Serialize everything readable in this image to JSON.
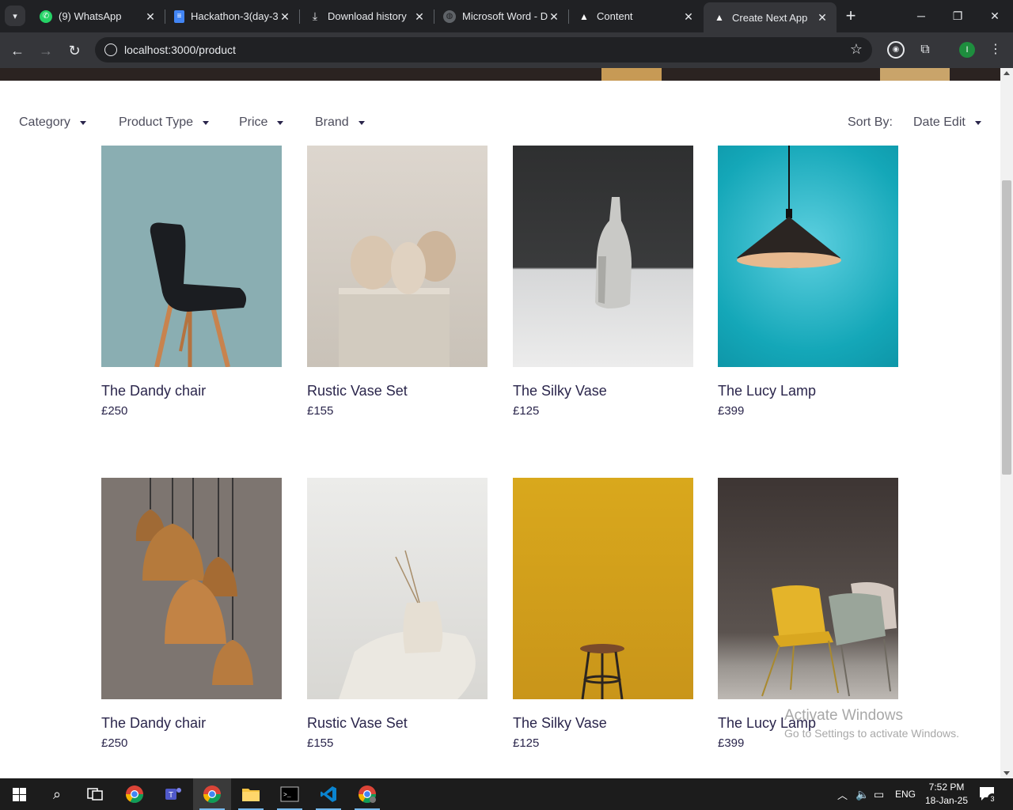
{
  "tabs": [
    {
      "title": "(9) WhatsApp",
      "icon": "whatsapp-icon"
    },
    {
      "title": "Hackathon-3(day-3",
      "icon": "docs-icon"
    },
    {
      "title": "Download history",
      "icon": "download-icon"
    },
    {
      "title": "Microsoft Word - D",
      "icon": "globe-icon"
    },
    {
      "title": "Content",
      "icon": "triangle-icon"
    },
    {
      "title": "Create Next App",
      "icon": "triangle-icon",
      "active": true
    }
  ],
  "address": {
    "url": "localhost:3000/product"
  },
  "profile": {
    "initial": "I"
  },
  "filters": {
    "category": "Category",
    "product_type": "Product Type",
    "price": "Price",
    "brand": "Brand",
    "sort_label": "Sort By:",
    "sort_value": "Date Edit"
  },
  "products": [
    {
      "name": "The Dandy chair",
      "price": "£250",
      "image": "black-chair"
    },
    {
      "name": "Rustic Vase Set",
      "price": "£155",
      "image": "clay-vases"
    },
    {
      "name": "The Silky Vase",
      "price": "£125",
      "image": "white-vase"
    },
    {
      "name": "The Lucy Lamp",
      "price": "£399",
      "image": "pendant-lamp"
    },
    {
      "name": "The Dandy chair",
      "price": "£250",
      "image": "copper-lamps"
    },
    {
      "name": "Rustic Vase Set",
      "price": "£155",
      "image": "ceramic-vase"
    },
    {
      "name": "The Silky Vase",
      "price": "£125",
      "image": "stool-yellow"
    },
    {
      "name": "The Lucy Lamp",
      "price": "£399",
      "image": "chairs-pair"
    }
  ],
  "watermark": {
    "line1": "Activate Windows",
    "line2": "Go to Settings to activate Windows."
  },
  "system_tray": {
    "lang": "ENG",
    "time": "7:52 PM",
    "date": "18-Jan-25",
    "notifications": "3"
  },
  "colors": {
    "title_bar": "#202124",
    "toolbar": "#35363a",
    "text_primary": "#2a254b",
    "text_muted": "#4d4d5c"
  }
}
